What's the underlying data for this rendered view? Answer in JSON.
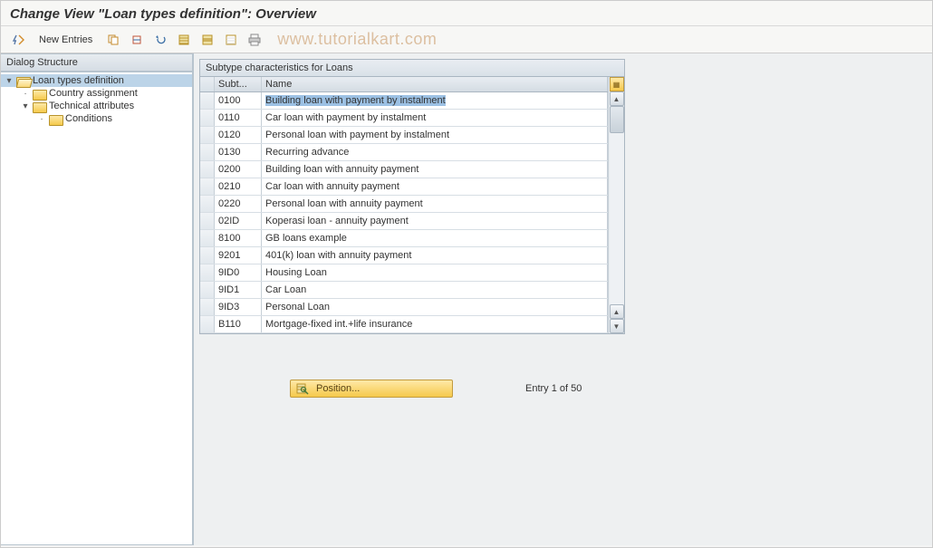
{
  "title": "Change View \"Loan types definition\": Overview",
  "toolbar": {
    "new_entries": "New Entries"
  },
  "watermark": "www.tutorialkart.com",
  "sidebar": {
    "heading": "Dialog Structure",
    "items": [
      {
        "label": "Loan types definition",
        "level": 0,
        "open": true,
        "selected": true,
        "expander": "▾"
      },
      {
        "label": "Country assignment",
        "level": 1,
        "open": false,
        "expander": "•"
      },
      {
        "label": "Technical attributes",
        "level": 1,
        "open": false,
        "expander": "▾"
      },
      {
        "label": "Conditions",
        "level": 2,
        "open": false,
        "expander": "•"
      }
    ]
  },
  "table": {
    "title": "Subtype characteristics for Loans",
    "columns": {
      "sub": "Subt...",
      "name": "Name"
    },
    "rows": [
      {
        "sub": "0100",
        "name": "Building loan with payment by instalment",
        "selected": true
      },
      {
        "sub": "0110",
        "name": "Car loan with payment by instalment"
      },
      {
        "sub": "0120",
        "name": "Personal loan with payment by instalment"
      },
      {
        "sub": "0130",
        "name": "Recurring advance"
      },
      {
        "sub": "0200",
        "name": "Building loan with annuity payment"
      },
      {
        "sub": "0210",
        "name": "Car loan with annuity payment"
      },
      {
        "sub": "0220",
        "name": "Personal loan with annuity payment"
      },
      {
        "sub": "02ID",
        "name": "Koperasi loan - annuity payment"
      },
      {
        "sub": "8100",
        "name": "GB loans example"
      },
      {
        "sub": "9201",
        "name": "401(k) loan with annuity payment"
      },
      {
        "sub": "9ID0",
        "name": "Housing Loan"
      },
      {
        "sub": "9ID1",
        "name": "Car Loan"
      },
      {
        "sub": "9ID3",
        "name": "Personal Loan"
      },
      {
        "sub": "B110",
        "name": "Mortgage-fixed int.+life insurance"
      }
    ]
  },
  "footer": {
    "position_button": "Position...",
    "entry_info": "Entry 1 of 50"
  },
  "colors": {
    "accent_folder": "#f5c94b",
    "selection": "#9cc1e4"
  }
}
